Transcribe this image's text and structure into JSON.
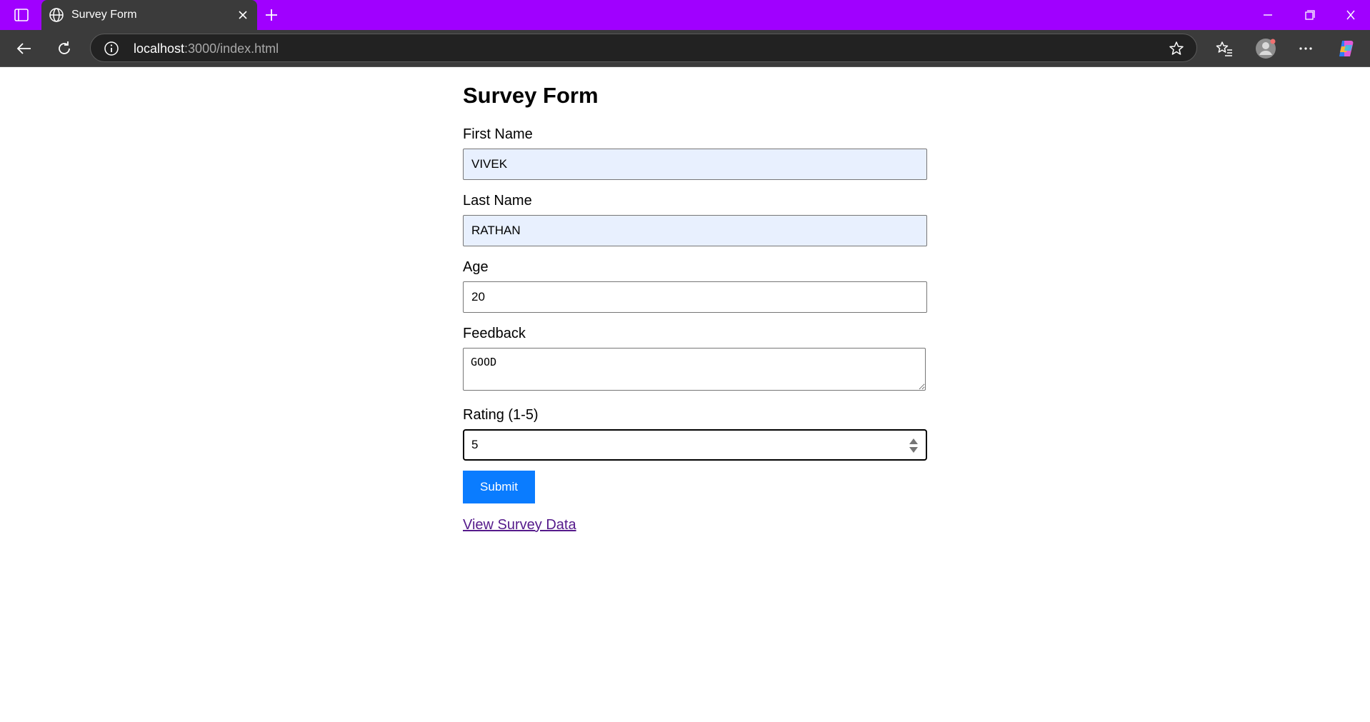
{
  "browser": {
    "tab_title": "Survey Form",
    "url_host": "localhost",
    "url_rest": ":3000/index.html",
    "tabstrip_color": "#a000ff",
    "icons": {
      "tab_actions": "tab-actions-icon",
      "favicon": "globe-icon",
      "tab_close": "close-icon",
      "new_tab": "plus-icon",
      "back": "back-arrow-icon",
      "reload": "reload-icon",
      "site_info": "info-icon",
      "favorite": "star-icon",
      "favorites_list": "favorites-icon",
      "profile": "profile-avatar-icon",
      "menu": "more-icon",
      "copilot": "copilot-icon"
    }
  },
  "form": {
    "title": "Survey Form",
    "first_name": {
      "label": "First Name",
      "value": "VIVEK"
    },
    "last_name": {
      "label": "Last Name",
      "value": "RATHAN"
    },
    "age": {
      "label": "Age",
      "value": "20"
    },
    "feedback": {
      "label": "Feedback",
      "value": "GOOD"
    },
    "rating": {
      "label": "Rating (1-5)",
      "value": "5"
    },
    "submit_label": "Submit",
    "view_link": "View Survey Data",
    "colors": {
      "submit_bg": "#0a7cff",
      "link": "#551a8b",
      "autofill_bg": "#e8f0fe"
    }
  }
}
